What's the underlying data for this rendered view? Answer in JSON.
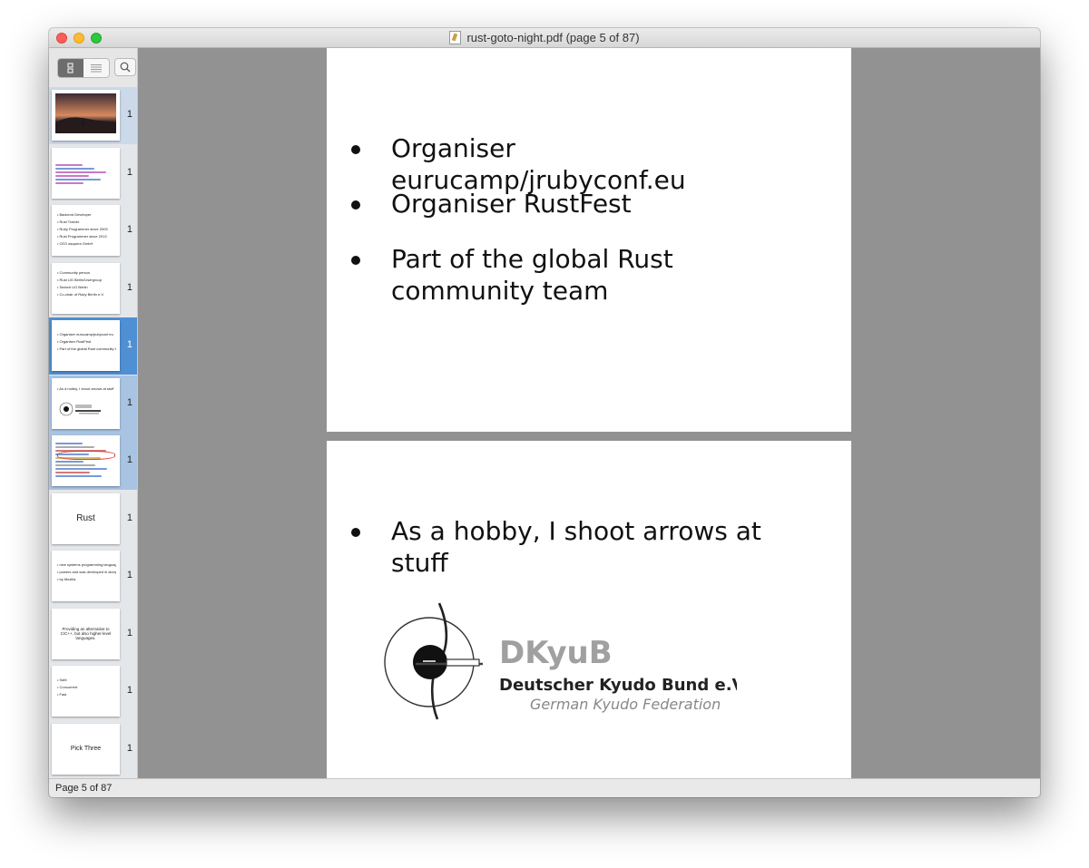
{
  "window": {
    "title": "rust-goto-night.pdf (page 5 of 87)"
  },
  "sidebar": {
    "view_toggle": [
      "thumbnails-icon",
      "list-icon"
    ],
    "search_icon": "magnifier-icon",
    "thumbnails": [
      {
        "kind": "photo",
        "num": "1"
      },
      {
        "kind": "code",
        "num": "1"
      },
      {
        "kind": "bullets",
        "num": "1",
        "lines": [
          "Backend Developer",
          "Rust Trainer",
          "Ruby Programmer since 2003",
          "Rust Programmer since 2013",
          "CEO asquera GmbH"
        ]
      },
      {
        "kind": "bullets",
        "num": "1",
        "lines": [
          "Community person",
          "Rust UG Berlin/Usergroup",
          "Search UG Berlin",
          "Co-chair of Ruby Berlin e.V."
        ]
      },
      {
        "kind": "bullets",
        "num": "1",
        "lines": [
          "Organiser eurucamp/jrubyconf.eu",
          "Organiser RustFest",
          "Part of the global Rust community team"
        ]
      },
      {
        "kind": "logo",
        "num": "1",
        "lines": [
          "As a hobby, I shoot arrows at stuff"
        ]
      },
      {
        "kind": "code2",
        "num": "1"
      },
      {
        "kind": "center",
        "num": "1",
        "text": "Rust"
      },
      {
        "kind": "bullets",
        "num": "1",
        "lines": [
          "new systems programming language",
          "powers and was developed in along with Servo, a new browser engine",
          "by Mozilla"
        ]
      },
      {
        "kind": "center",
        "num": "1",
        "text": "Providing an alternative to C/C++, but also higher-level languages."
      },
      {
        "kind": "bullets",
        "num": "1",
        "lines": [
          "Safe",
          "Concurrent",
          "Fast"
        ]
      },
      {
        "kind": "center",
        "num": "1",
        "text": "Pick Three"
      }
    ]
  },
  "pages": {
    "page5": {
      "bullets": [
        "Organiser eurucamp/jrubyconf.eu",
        "Organiser RustFest",
        "Part of the global Rust community team"
      ]
    },
    "page6": {
      "bullets": [
        "As a hobby, I shoot arrows at stuff"
      ],
      "logo": {
        "abbr": "DKyuB",
        "name": "Deutscher Kyudo Bund e.V.",
        "subtitle": "German Kyudo Federation"
      }
    }
  },
  "status": {
    "text": "Page 5 of 87"
  },
  "colors": {
    "selection": "#4f8fd3",
    "canvas": "#929292"
  }
}
